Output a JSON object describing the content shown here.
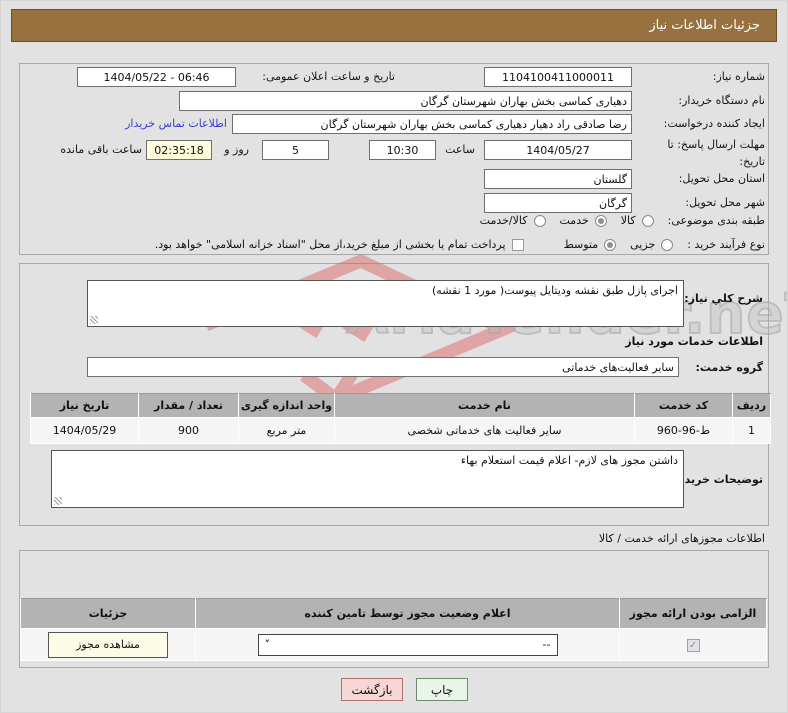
{
  "colors": {
    "header-bg": "#97713F",
    "link": "#3b3bd1",
    "countdown-bg": "#FFFBDD",
    "back-bg": "#F7D6D6",
    "print-bg": "#E9F5E9",
    "wm-red": "#DD5B5B",
    "tbl-head": "#b3b3b3"
  },
  "watermark": {
    "text": "AriaTender.neT",
    "logo": "aria-tender-logo"
  },
  "header": {
    "title": "جزئیات اطلاعات نیاز"
  },
  "info": {
    "need_number": {
      "label": "شماره نیاز:",
      "value": "1104100411000011"
    },
    "announce": {
      "label": "تاریخ و ساعت اعلان عمومی:",
      "value": "1404/05/22 - 06:46"
    },
    "buyer_org": {
      "label": "نام دستگاه خریدار:",
      "value": "دهیاری کماسی بخش بهاران شهرستان گرگان"
    },
    "creator": {
      "label": "ایجاد کننده درخواست:",
      "value": "رضا صادقی راد دهیار دهیاری کماسی بخش بهاران شهرستان گرگان"
    },
    "contact_link": "اطلاعات تماس خریدار",
    "deadline": {
      "label": "مهلت ارسال پاسخ: تا تاریخ:",
      "date": "1404/05/27",
      "hour_label": "ساعت",
      "time": "10:30",
      "days": "5",
      "days_label": "روز و",
      "countdown": "02:35:18",
      "remain_label": "ساعت باقی مانده"
    },
    "province": {
      "label": "استان محل تحویل:",
      "value": "گلستان"
    },
    "city": {
      "label": "شهر محل تحویل:",
      "value": "گرگان"
    },
    "classification": {
      "label": "طبقه بندی موضوعی:",
      "options": [
        {
          "label": "کالا",
          "selected": false
        },
        {
          "label": "خدمت",
          "selected": true
        },
        {
          "label": "کالا/خدمت",
          "selected": false
        }
      ]
    },
    "process": {
      "label": "نوع فرآیند خرید :",
      "options": [
        {
          "label": "جزیی",
          "selected": false
        },
        {
          "label": "متوسط",
          "selected": true
        }
      ],
      "treasury_label": "پرداخت تمام یا بخشی از مبلغ خرید،از محل \"اسناد خزانه اسلامی\" خواهد بود.",
      "treasury_checked": false
    }
  },
  "need": {
    "label": "شرح کلي نیاز:",
    "value": "اجرای پازل طبق نقشه ودیتایل پیوست( مورد 1 نقشه)"
  },
  "services": {
    "heading": "اطلاعات خدمات مورد نیاز",
    "group_label": "گروه خدمت:",
    "group_value": "سایر فعالیت‌های خدماتی",
    "table": {
      "headers": [
        "ردیف",
        "کد خدمت",
        "نام خدمت",
        "واحد اندازه گیری",
        "تعداد / مقدار",
        "تاریخ نیاز"
      ],
      "rows": [
        [
          "1",
          "ط-96-960",
          "سایر فعالیت های خدماتی شخصی",
          "متر مربع",
          "900",
          "1404/05/29"
        ]
      ]
    }
  },
  "buyer_notes": {
    "label": "توضیحات خریدار:",
    "value": "داشتن مجوز های لازم- اعلام قیمت استعلام بهاء"
  },
  "licenses": {
    "heading": "اطلاعات مجوزهای ارائه خدمت / کالا",
    "table": {
      "headers": [
        "الزامی بودن ارائه مجوز",
        "اعلام وضعیت مجوز توسط تامین کننده",
        "جزئیات"
      ],
      "row": {
        "required_checked": true,
        "status_value": "--",
        "details_button": "مشاهده مجوز"
      }
    }
  },
  "footer": {
    "back_button": "بازگشت",
    "print_button": "چاپ"
  }
}
